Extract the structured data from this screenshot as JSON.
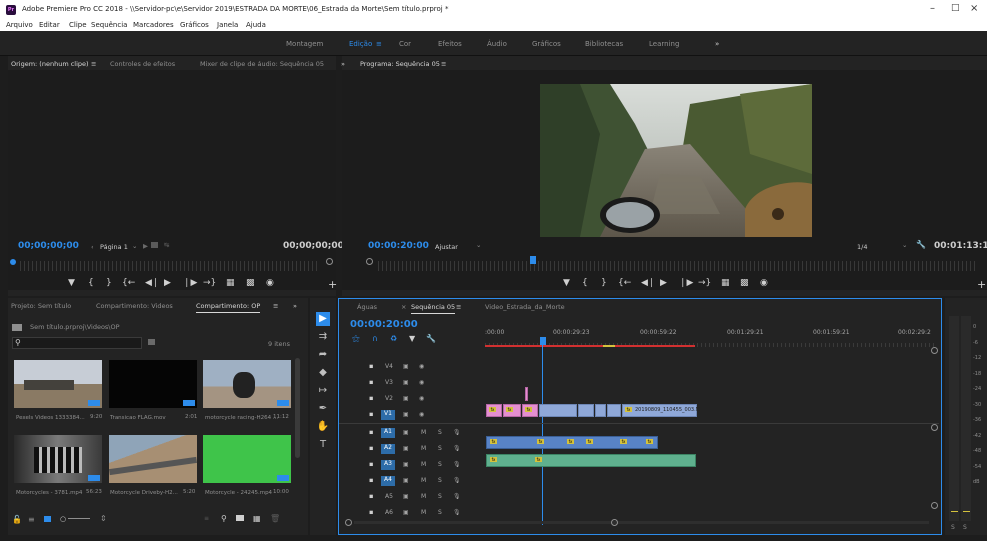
{
  "window": {
    "title": "Adobe Premiere Pro CC 2018 - \\\\Servidor-pc\\e\\Servidor 2019\\ESTRADA DA MORTE\\06_Estrada da Morte\\Sem título.prproj *",
    "app_badge": "Pr"
  },
  "menu": [
    "Arquivo",
    "Editar",
    "Clipe",
    "Sequência",
    "Marcadores",
    "Gráficos",
    "Janela",
    "Ajuda"
  ],
  "workspaces": {
    "items": [
      "Montagem",
      "Edição",
      "Cor",
      "Efeitos",
      "Áudio",
      "Gráficos",
      "Bibliotecas",
      "Learning"
    ],
    "active": "Edição",
    "more": "»"
  },
  "source_monitor": {
    "tabs": [
      "Origem: (nenhum clipe)",
      "Controles de efeitos",
      "Mixer de clipe de áudio: Sequência 05"
    ],
    "more": "»",
    "timecode_in": "00;00;00;00",
    "page_label": "Página 1",
    "timecode_out": "00;00;00;00"
  },
  "program_monitor": {
    "title": "Programa: Sequência 05",
    "timecode": "00:00:20:00",
    "fit": "Ajustar",
    "resolution": "1/4",
    "duration": "00:01:13:14"
  },
  "project_panel": {
    "tabs": [
      "Projeto: Sem título",
      "Compartimento: Videos",
      "Compartimento: OP"
    ],
    "more": "»",
    "path": "Sem título.prproj\\Videos\\OP",
    "search_placeholder": "",
    "item_count": "9 itens",
    "items": [
      {
        "name": "Pexels Videos 1333384...",
        "dur": "9:20"
      },
      {
        "name": "Transicao FLAG.mov",
        "dur": "2:01"
      },
      {
        "name": "motorcycle racing-H264 ...",
        "dur": "11:12"
      },
      {
        "name": "Motorcycles - 3781.mp4",
        "dur": "56:23"
      },
      {
        "name": "Motorcycle Driveby-H2...",
        "dur": "5:20"
      },
      {
        "name": "Motorcycle - 24245.mp4",
        "dur": "10:00"
      }
    ]
  },
  "timeline": {
    "tabs": [
      "Águas",
      "Sequência 05",
      "Video_Estrada_da_Morte"
    ],
    "timecode": "00:00:20:00",
    "ruler": [
      ":00:00",
      "00:00:29:23",
      "00:00:59:22",
      "00:01:29:21",
      "00:01:59:21",
      "00:02:29:2"
    ],
    "video_tracks": [
      "V4",
      "V3",
      "V2",
      "V1"
    ],
    "audio_tracks": [
      "A1",
      "A2",
      "A3",
      "A4",
      "A5",
      "A6"
    ],
    "clip_name": "20190809_110455_003.M"
  },
  "meters": {
    "scale": [
      "0",
      "-6",
      "-12",
      "-18",
      "-24",
      "-30",
      "-36",
      "-42",
      "-48",
      "-54",
      "dB"
    ],
    "solo": [
      "S",
      "S"
    ]
  },
  "colors": {
    "accent": "#2d8ceb",
    "video_clip": "#8fa8d8",
    "pink_clip": "#e48fd0",
    "audio_clip": "#5883c6",
    "green_clip": "#5fb08e",
    "playhead": "#2d8ceb"
  }
}
